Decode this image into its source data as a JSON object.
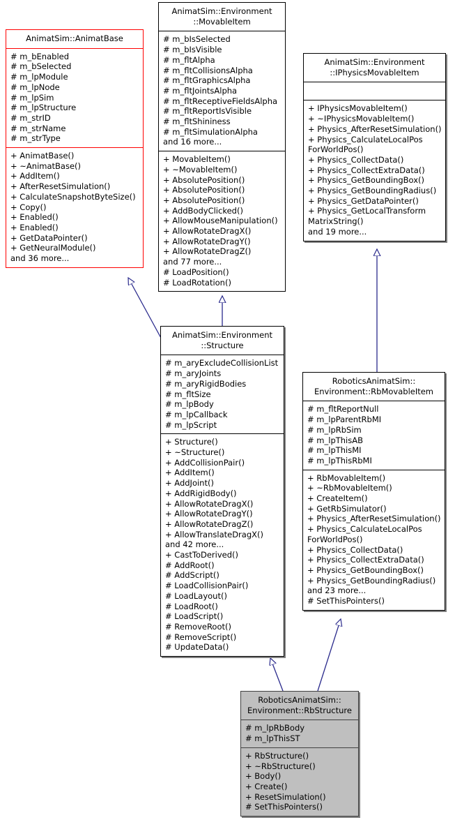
{
  "diagram": {
    "kind": "uml-class-inheritance-diagram",
    "colors": {
      "edge": "#2a2a8c",
      "accent_border": "#ff0000",
      "default_border": "#000000",
      "highlight_fill": "#bfbfbf",
      "highlight_border": "#404040",
      "shadow": "#808080",
      "background": "#ffffff"
    },
    "nodes": [
      {
        "id": "animatbase",
        "title": "AnimatSim::AnimatBase",
        "style": "accent",
        "attributes": [
          "# m_bEnabled",
          "# m_bSelected",
          "# m_lpModule",
          "# m_lpNode",
          "# m_lpSim",
          "# m_lpStructure",
          "# m_strID",
          "# m_strName",
          "# m_strType"
        ],
        "operations": [
          "+ AnimatBase()",
          "+ ~AnimatBase()",
          "+ AddItem()",
          "+ AfterResetSimulation()",
          "+ CalculateSnapshotByteSize()",
          "+ Copy()",
          "+ Enabled()",
          "+ Enabled()",
          "+ GetDataPointer()",
          "+ GetNeuralModule()",
          "and 36 more..."
        ]
      },
      {
        "id": "movableitem",
        "title": "AnimatSim::Environment\n::MovableItem",
        "style": "plain",
        "attributes": [
          "# m_bIsSelected",
          "# m_bIsVisible",
          "# m_fltAlpha",
          "# m_fltCollisionsAlpha",
          "# m_fltGraphicsAlpha",
          "# m_fltJointsAlpha",
          "# m_fltReceptiveFieldsAlpha",
          "# m_fltReportIsVisible",
          "# m_fltShininess",
          "# m_fltSimulationAlpha",
          "and 16 more..."
        ],
        "operations": [
          "+ MovableItem()",
          "+ ~MovableItem()",
          "+ AbsolutePosition()",
          "+ AbsolutePosition()",
          "+ AbsolutePosition()",
          "+ AddBodyClicked()",
          "+ AllowMouseManipulation()",
          "+ AllowRotateDragX()",
          "+ AllowRotateDragY()",
          "+ AllowRotateDragZ()",
          "and 77 more...",
          "# LoadPosition()",
          "# LoadRotation()"
        ]
      },
      {
        "id": "iphysicsmovableitem",
        "title": "AnimatSim::Environment\n::IPhysicsMovableItem",
        "style": "plain",
        "attributes": [],
        "operations": [
          "+ IPhysicsMovableItem()",
          "+ ~IPhysicsMovableItem()",
          "+ Physics_AfterResetSimulation()",
          "+ Physics_CalculateLocalPos",
          "ForWorldPos()",
          "+ Physics_CollectData()",
          "+ Physics_CollectExtraData()",
          "+ Physics_GetBoundingBox()",
          "+ Physics_GetBoundingRadius()",
          "+ Physics_GetDataPointer()",
          "+ Physics_GetLocalTransform",
          "MatrixString()",
          "and 19 more..."
        ]
      },
      {
        "id": "structure",
        "title": "AnimatSim::Environment\n::Structure",
        "style": "plain",
        "attributes": [
          "# m_aryExcludeCollisionList",
          "# m_aryJoints",
          "# m_aryRigidBodies",
          "# m_fltSize",
          "# m_lpBody",
          "# m_lpCallback",
          "# m_lpScript"
        ],
        "operations": [
          "+ Structure()",
          "+ ~Structure()",
          "+ AddCollisionPair()",
          "+ AddItem()",
          "+ AddJoint()",
          "+ AddRigidBody()",
          "+ AllowRotateDragX()",
          "+ AllowRotateDragY()",
          "+ AllowRotateDragZ()",
          "+ AllowTranslateDragX()",
          "and 42 more...",
          "+ CastToDerived()",
          "# AddRoot()",
          "# AddScript()",
          "# LoadCollisionPair()",
          "# LoadLayout()",
          "# LoadRoot()",
          "# LoadScript()",
          "# RemoveRoot()",
          "# RemoveScript()",
          "# UpdateData()"
        ]
      },
      {
        "id": "rbmovableitem",
        "title": "RoboticsAnimatSim::\nEnvironment::RbMovableItem",
        "style": "plain",
        "attributes": [
          "# m_fltReportNull",
          "# m_lpParentRbMI",
          "# m_lpRbSim",
          "# m_lpThisAB",
          "# m_lpThisMI",
          "# m_lpThisRbMI"
        ],
        "operations": [
          "+ RbMovableItem()",
          "+ ~RbMovableItem()",
          "+ CreateItem()",
          "+ GetRbSimulator()",
          "+ Physics_AfterResetSimulation()",
          "+ Physics_CalculateLocalPos",
          "ForWorldPos()",
          "+ Physics_CollectData()",
          "+ Physics_CollectExtraData()",
          "+ Physics_GetBoundingBox()",
          "+ Physics_GetBoundingRadius()",
          "and 23 more...",
          "# SetThisPointers()"
        ]
      },
      {
        "id": "rbstructure",
        "title": "RoboticsAnimatSim::\nEnvironment::RbStructure",
        "style": "highlight",
        "attributes": [
          "# m_lpRbBody",
          "# m_lpThisST"
        ],
        "operations": [
          "+ RbStructure()",
          "+ ~RbStructure()",
          "+ Body()",
          "+ Create()",
          "+ ResetSimulation()",
          "# SetThisPointers()"
        ]
      }
    ],
    "edges": [
      {
        "from": "structure",
        "to": "animatbase",
        "type": "inheritance"
      },
      {
        "from": "structure",
        "to": "movableitem",
        "type": "inheritance"
      },
      {
        "from": "rbmovableitem",
        "to": "iphysicsmovableitem",
        "type": "inheritance"
      },
      {
        "from": "rbstructure",
        "to": "structure",
        "type": "inheritance"
      },
      {
        "from": "rbstructure",
        "to": "rbmovableitem",
        "type": "inheritance"
      }
    ]
  }
}
